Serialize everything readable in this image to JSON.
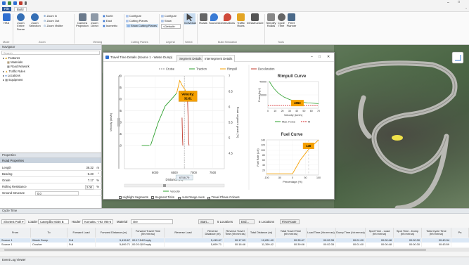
{
  "app": {
    "tabs": [
      "File",
      "Build"
    ]
  },
  "ribbon": {
    "buttons": [
      {
        "label": "HRA",
        "icon": "hra-icon"
      },
      {
        "label": "Zoom Entire Scene",
        "icon": "zoom-entire-icon"
      },
      {
        "label": "Zoom Selection",
        "icon": "zoom-selection-icon"
      },
      {
        "label": "Camera Projection",
        "icon": "camera-icon"
      },
      {
        "label": "Zoom Direct",
        "icon": "zoom-direct-icon"
      },
      {
        "label": "Individual",
        "icon": "cursor-icon"
      },
      {
        "label": "Roads",
        "icon": "roads-icon"
      },
      {
        "label": "Sources",
        "icon": "sources-icon"
      },
      {
        "label": "Destinations",
        "icon": "destinations-icon"
      },
      {
        "label": "Traffic Rules",
        "icon": "traffic-rules-icon"
      },
      {
        "label": "Infrastructure",
        "icon": "infrastructure-icon"
      },
      {
        "label": "Simplify Roads",
        "icon": "simplify-icon"
      },
      {
        "label": "Cycle Time",
        "icon": "cycle-time-icon"
      },
      {
        "label": "Fleet Planner",
        "icon": "fleet-planner-icon"
      }
    ],
    "small": [
      "Zoom In",
      "Zoom Out",
      "Zoom Visible",
      "North",
      "East",
      "Isometric",
      "Configure",
      "Cutting Planes",
      "Show Cutting Planes",
      "Configure",
      "Show",
      "<Default>"
    ],
    "groups": [
      "Mode",
      "Zoom",
      "Viewing",
      "Cutting Planes",
      "Legend",
      "Select",
      "Build Simulation",
      "Tools"
    ]
  },
  "navigator": {
    "title": "Navigator",
    "search": "Search",
    "items": [
      "Features",
      "Materials",
      "Road Network",
      "Traffic Rules",
      "Locations",
      "Equipment"
    ]
  },
  "properties": {
    "title": "Properties",
    "section": "Road Properties",
    "rows": [
      {
        "label": "Length",
        "value": "38.32",
        "unit": "m"
      },
      {
        "label": "Bearing",
        "value": "-5.20",
        "unit": "°"
      },
      {
        "label": "Grade",
        "value": "7.17",
        "unit": "%"
      },
      {
        "label": "Rolling Resistance",
        "value": "2.00",
        "unit": "%"
      },
      {
        "label": "Ground Structure",
        "value": "0.0",
        "unit": ""
      }
    ]
  },
  "dialog": {
    "title": "Travel Time Details (Source 1 - Waste Dump)",
    "tabs": [
      "Segment Details",
      "Intersegment Details"
    ],
    "legend": [
      "Cruise",
      "Traction",
      "Rimpull",
      "Deceleration"
    ],
    "checkboxes": [
      {
        "label": "Highlight Segments",
        "checked": false
      },
      {
        "label": "Segment Ticks",
        "checked": false
      },
      {
        "label": "Auto Range Axes",
        "checked": true
      },
      {
        "label": "Travel Phase Colours",
        "checked": true
      }
    ]
  },
  "chart_data": [
    {
      "type": "line",
      "xlabel": "Distance (m)",
      "ylabel": "Velocity (km/h)",
      "y2label": "Road segment grade (%)",
      "xlim": [
        5200,
        7800
      ],
      "ylim": [
        0,
        40
      ],
      "y2lim": [
        4,
        7
      ],
      "x_ticks": [
        "6000",
        "6500",
        "7000",
        "7500"
      ],
      "y_ticks": [
        "10",
        "15",
        "20",
        "25",
        "30",
        "35",
        "40"
      ],
      "y2_ticks": [
        "4.5",
        "5",
        "5.5",
        "6",
        "6.5",
        "7"
      ],
      "cursor_label": "6758.79",
      "callout": {
        "label": "Velocity:",
        "value": "32.61"
      },
      "legend": [
        "Velocity"
      ],
      "series": [
        {
          "name": "Velocity",
          "color": "#2ca02c",
          "x": [
            5650,
            5850
          ],
          "y": [
            10,
            10
          ]
        },
        {
          "color": "#2ca02c",
          "x": [
            5880,
            6080,
            6260,
            6480,
            6560
          ],
          "y": [
            10,
            20,
            27,
            31,
            32.6
          ]
        },
        {
          "color": "#f5a000",
          "x": [
            6560,
            6640,
            6700,
            6780,
            6840
          ],
          "y": [
            32.6,
            38,
            36,
            34,
            31
          ]
        },
        {
          "color": "#c0392b",
          "x": [
            6840,
            6860,
            6870,
            6880
          ],
          "y": [
            31,
            20,
            12,
            10
          ]
        },
        {
          "color": "#c0392b",
          "x": [
            6700,
            6710,
            6720
          ],
          "y": [
            22,
            14,
            10
          ]
        }
      ]
    },
    {
      "type": "line",
      "title": "Rimpull Curve",
      "xlabel": "Velocity (km/h)",
      "ylabel": "Force (kg-f)",
      "xlim": [
        0,
        70
      ],
      "ylim": [
        0,
        40000
      ],
      "x_ticks": [
        "0",
        "10",
        "20",
        "30",
        "40",
        "50",
        "60",
        "70"
      ],
      "y_ticks": [
        "20000",
        "40000"
      ],
      "callout": "4063",
      "legend": [
        "Max. Force",
        "M"
      ],
      "series": [
        {
          "name": "Max. Force",
          "color": "#2ca02c",
          "x": [
            2,
            8,
            15,
            22,
            30,
            40,
            55,
            70
          ],
          "y": [
            40000,
            30000,
            22000,
            17000,
            13000,
            10000,
            8000,
            7000
          ]
        },
        {
          "name": "M",
          "color": "#d62728",
          "x": [
            0,
            70
          ],
          "y": [
            4063,
            4063
          ]
        }
      ]
    },
    {
      "type": "line",
      "title": "Fuel Curve",
      "xlabel": "Percentage (%)",
      "ylabel": "Fuel Rate (L/h)",
      "xlim": [
        -100,
        100
      ],
      "ylim": [
        0,
        140
      ],
      "x_ticks": [
        "-100",
        "-50",
        "0",
        "50",
        "100"
      ],
      "y_ticks": [
        "20",
        "40",
        "60",
        "80",
        "100",
        "120",
        "140"
      ],
      "callout": "140",
      "series": [
        {
          "color": "#f5a000",
          "x": [
            -100,
            0,
            30,
            60,
            100
          ],
          "y": [
            5,
            5,
            60,
            100,
            140
          ]
        }
      ]
    }
  ],
  "cycle": {
    "title": "Cycle Time",
    "controls": {
      "route": "Shortest Path",
      "loader_label": "Loader",
      "loader": "Caterpillar 6030 B",
      "hauler_label": "Hauler",
      "hauler": "Komatsu - HD 785-5",
      "material_label": "Material",
      "material": "Ore",
      "start": "Start...",
      "start_locs": "5 Locations",
      "end": "End...",
      "end_locs": "5 Locations",
      "first_route": "First Route"
    },
    "headers": [
      "From",
      "To",
      "Forward Load",
      "Forward Distance (m)",
      "Forward Travel Time (hh:mm:ss)",
      "Reverse Load",
      "Reverse Distance (m)",
      "Reverse Travel Time (hh:mm:ss)",
      "Total Distance (m)",
      "Total Travel Time (hh:mm:ss)",
      "Load Time (hh:mm:ss)",
      "Dump Time (hh:mm:ss)",
      "Spot Time - Load (hh:mm:ss)",
      "Spot Time - Dump (hh:mm:ss)",
      "Total Cycle Time (hh:mm:ss)",
      "Pa"
    ],
    "rows": [
      [
        "Source 1",
        "Waste Dump",
        "Full",
        "5,415.67",
        "00:17:54",
        "Empty",
        "5,415.67",
        "00:17:53",
        "10,831.40",
        "00:35:47",
        "00:02:35",
        "00:01:00",
        "00:00:48",
        "00:00:30",
        "00:40:34"
      ],
      [
        "Source 1",
        "Crusher",
        "Full",
        "5,699.71",
        "00:20:10",
        "Empty",
        "5,699.71",
        "00:18:46",
        "11,399.42",
        "00:39:06",
        "00:02:35",
        "00:01:00",
        "00:00:48",
        "00:00:30",
        "00:43:59"
      ]
    ]
  },
  "status": {
    "event_log": "Event Log Viewer"
  }
}
